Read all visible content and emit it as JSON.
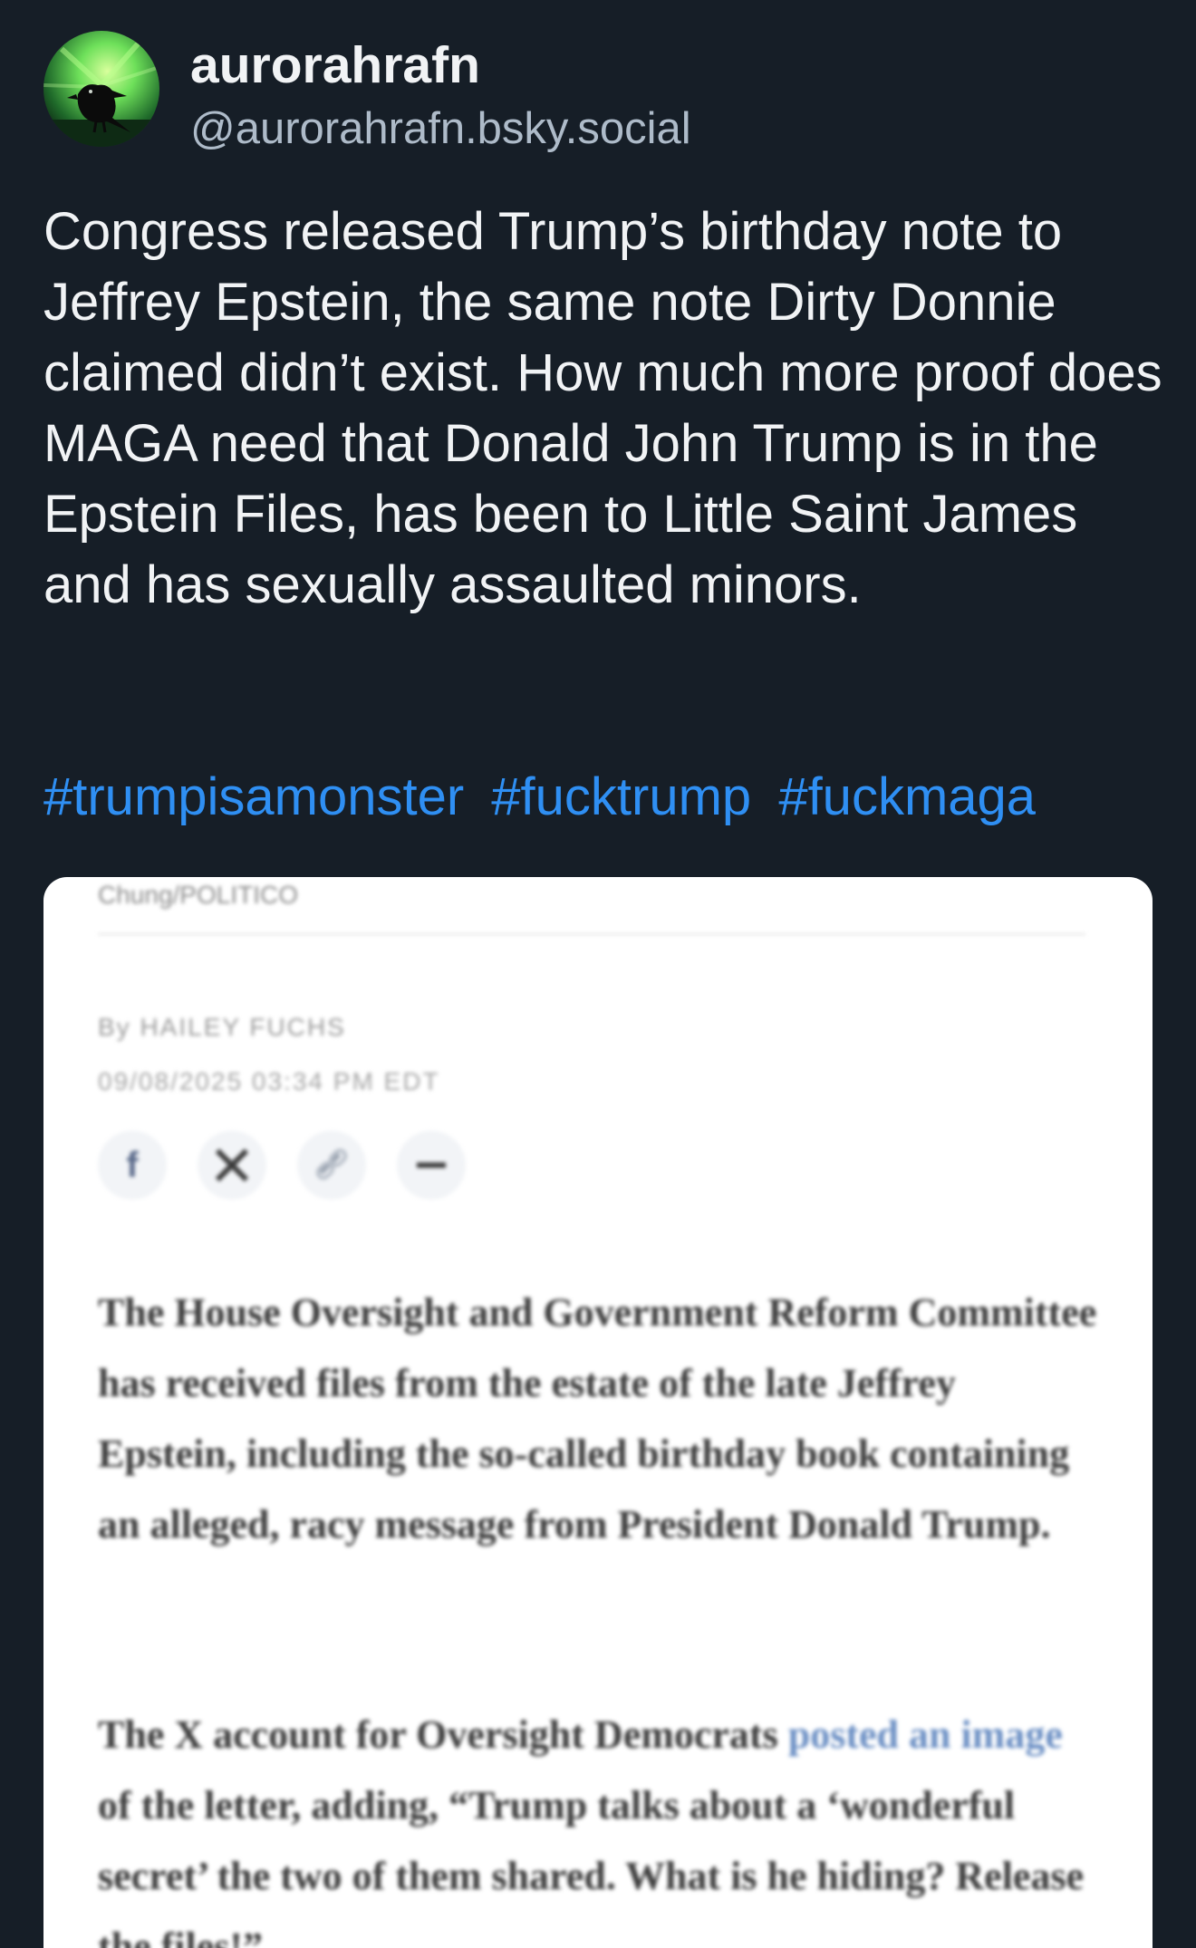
{
  "post": {
    "author": {
      "display_name": "aurorahrafn",
      "handle": "@aurorahrafn.bsky.social",
      "avatar_icon": "raven-aurora-avatar"
    },
    "text": "Congress released Trump’s birthday note to Jeffrey Epstein, the same note Dirty Donnie claimed didn’t exist. How much more proof does MAGA need that Donald John Trump is in the Epstein Files, has been to Little Saint James and has sexually assaulted minors.",
    "hashtags": [
      "#trumpisamonster",
      "#fucktrump",
      "#fuckmaga"
    ],
    "colors": {
      "background": "#161e27",
      "text": "#f1f3f5",
      "handle": "#aebbc9",
      "hashtag": "#2f8ff3"
    }
  },
  "embed": {
    "source_label": "Chung/POLITICO",
    "byline": "By HAILEY FUCHS",
    "dateline": "09/08/2025 03:34 PM EDT",
    "share_icons": [
      "facebook-icon",
      "x-icon",
      "link-icon",
      "more-icon"
    ],
    "paragraph_1": "The House Oversight and Government Reform Committee has received files from the estate of the late Jeffrey Epstein, including the so-called birthday book containing an alleged, racy message from President Donald Trump.",
    "paragraph_2": {
      "before_link": "The X account for Oversight Democrats ",
      "link_text": "posted an image",
      "after_link": " of the letter, adding, “Trump talks about a ‘wonderful secret’ the two of them shared. What is he hiding? Release the files!”"
    }
  }
}
